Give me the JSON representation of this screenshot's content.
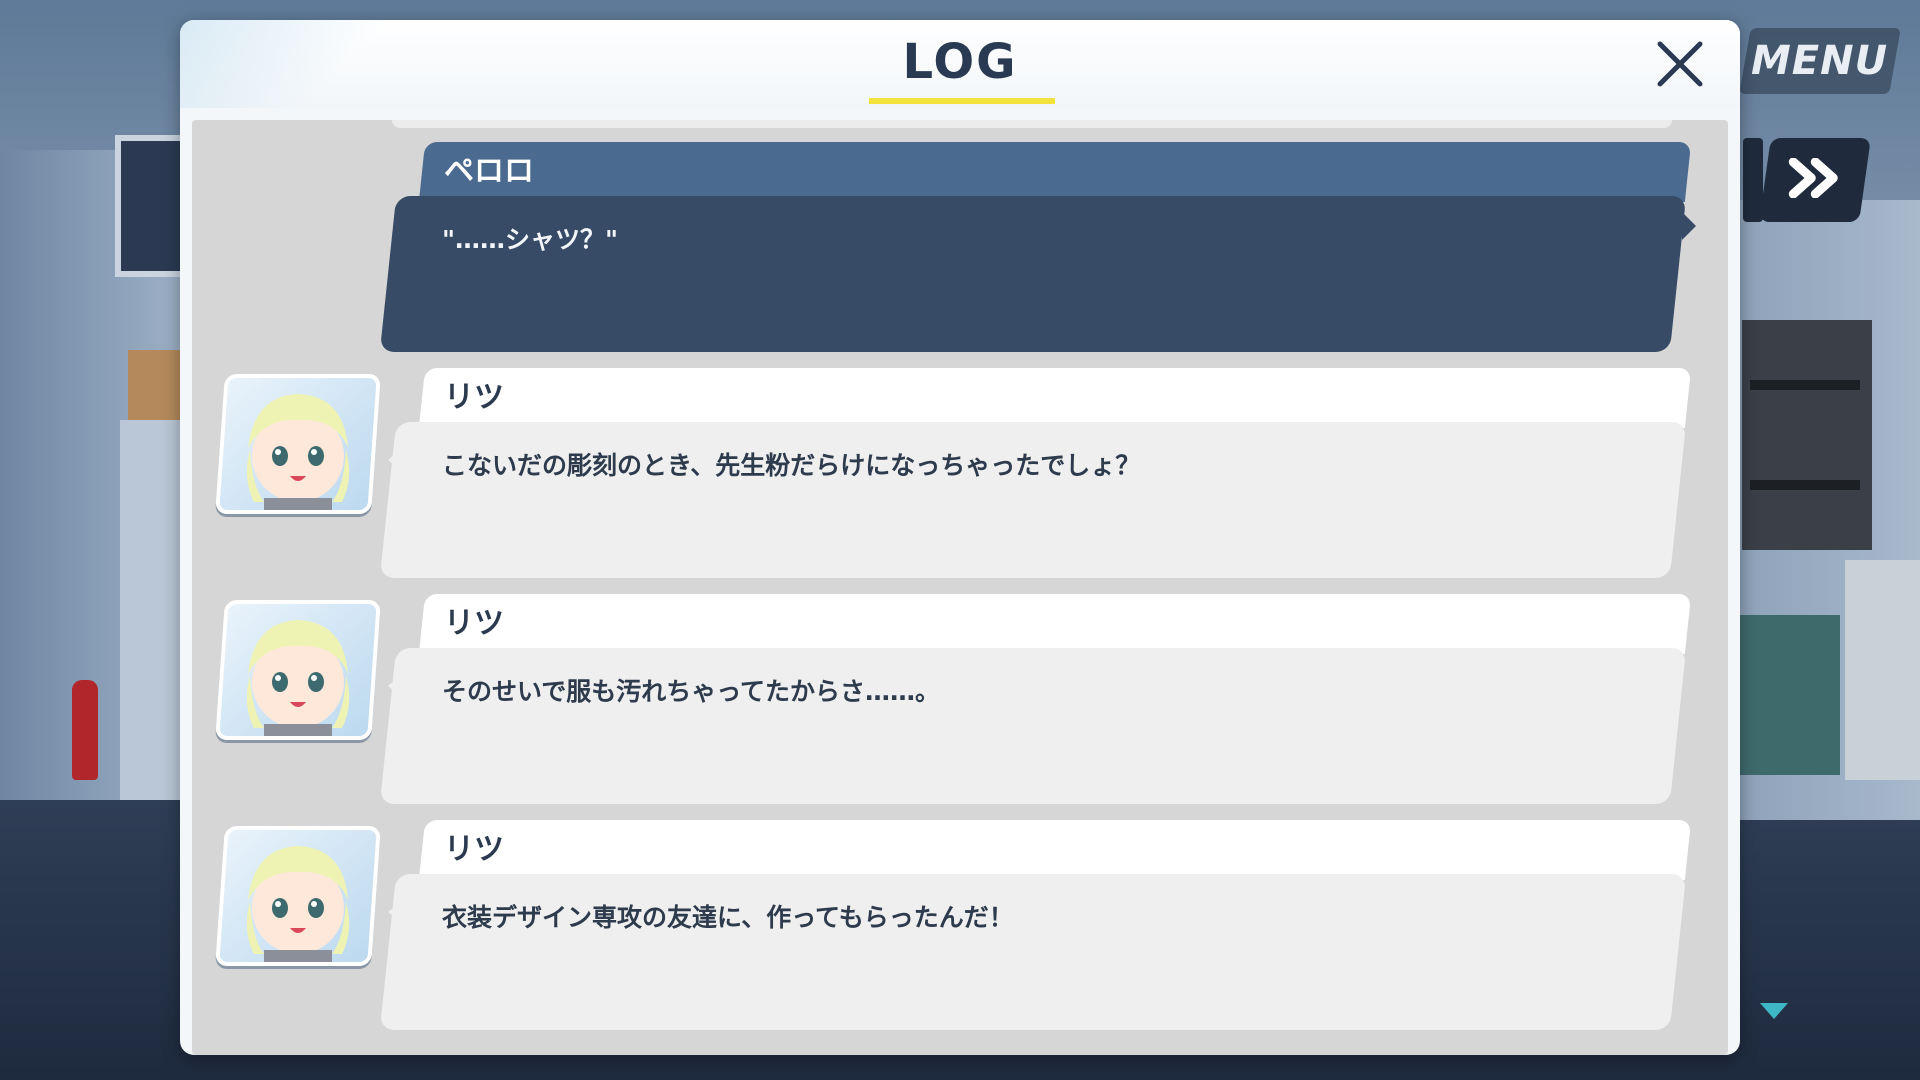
{
  "hud": {
    "menu_label": "MENU"
  },
  "log": {
    "title": "LOG",
    "entries": [
      {
        "speaker": "ペロロ",
        "text": "\"……シャツ？\"",
        "type": "player"
      },
      {
        "speaker": "リツ",
        "text": "こないだの彫刻のとき、先生粉だらけになっちゃったでしょ？",
        "type": "character"
      },
      {
        "speaker": "リツ",
        "text": "そのせいで服も汚れちゃってたからさ……。",
        "type": "character"
      },
      {
        "speaker": "リツ",
        "text": "衣装デザイン専攻の友達に、作ってもらったんだ！",
        "type": "character"
      }
    ]
  },
  "colors": {
    "title_underline": "#f4e23c",
    "player_name_bar": "#4b6a90",
    "player_body": "#374a66",
    "character_body": "#efefef",
    "scroll_indicator": "#3fb6c4"
  },
  "icons": {
    "close": "close-icon",
    "skip": "fast-forward-icon",
    "scroll": "chevron-down-icon"
  }
}
